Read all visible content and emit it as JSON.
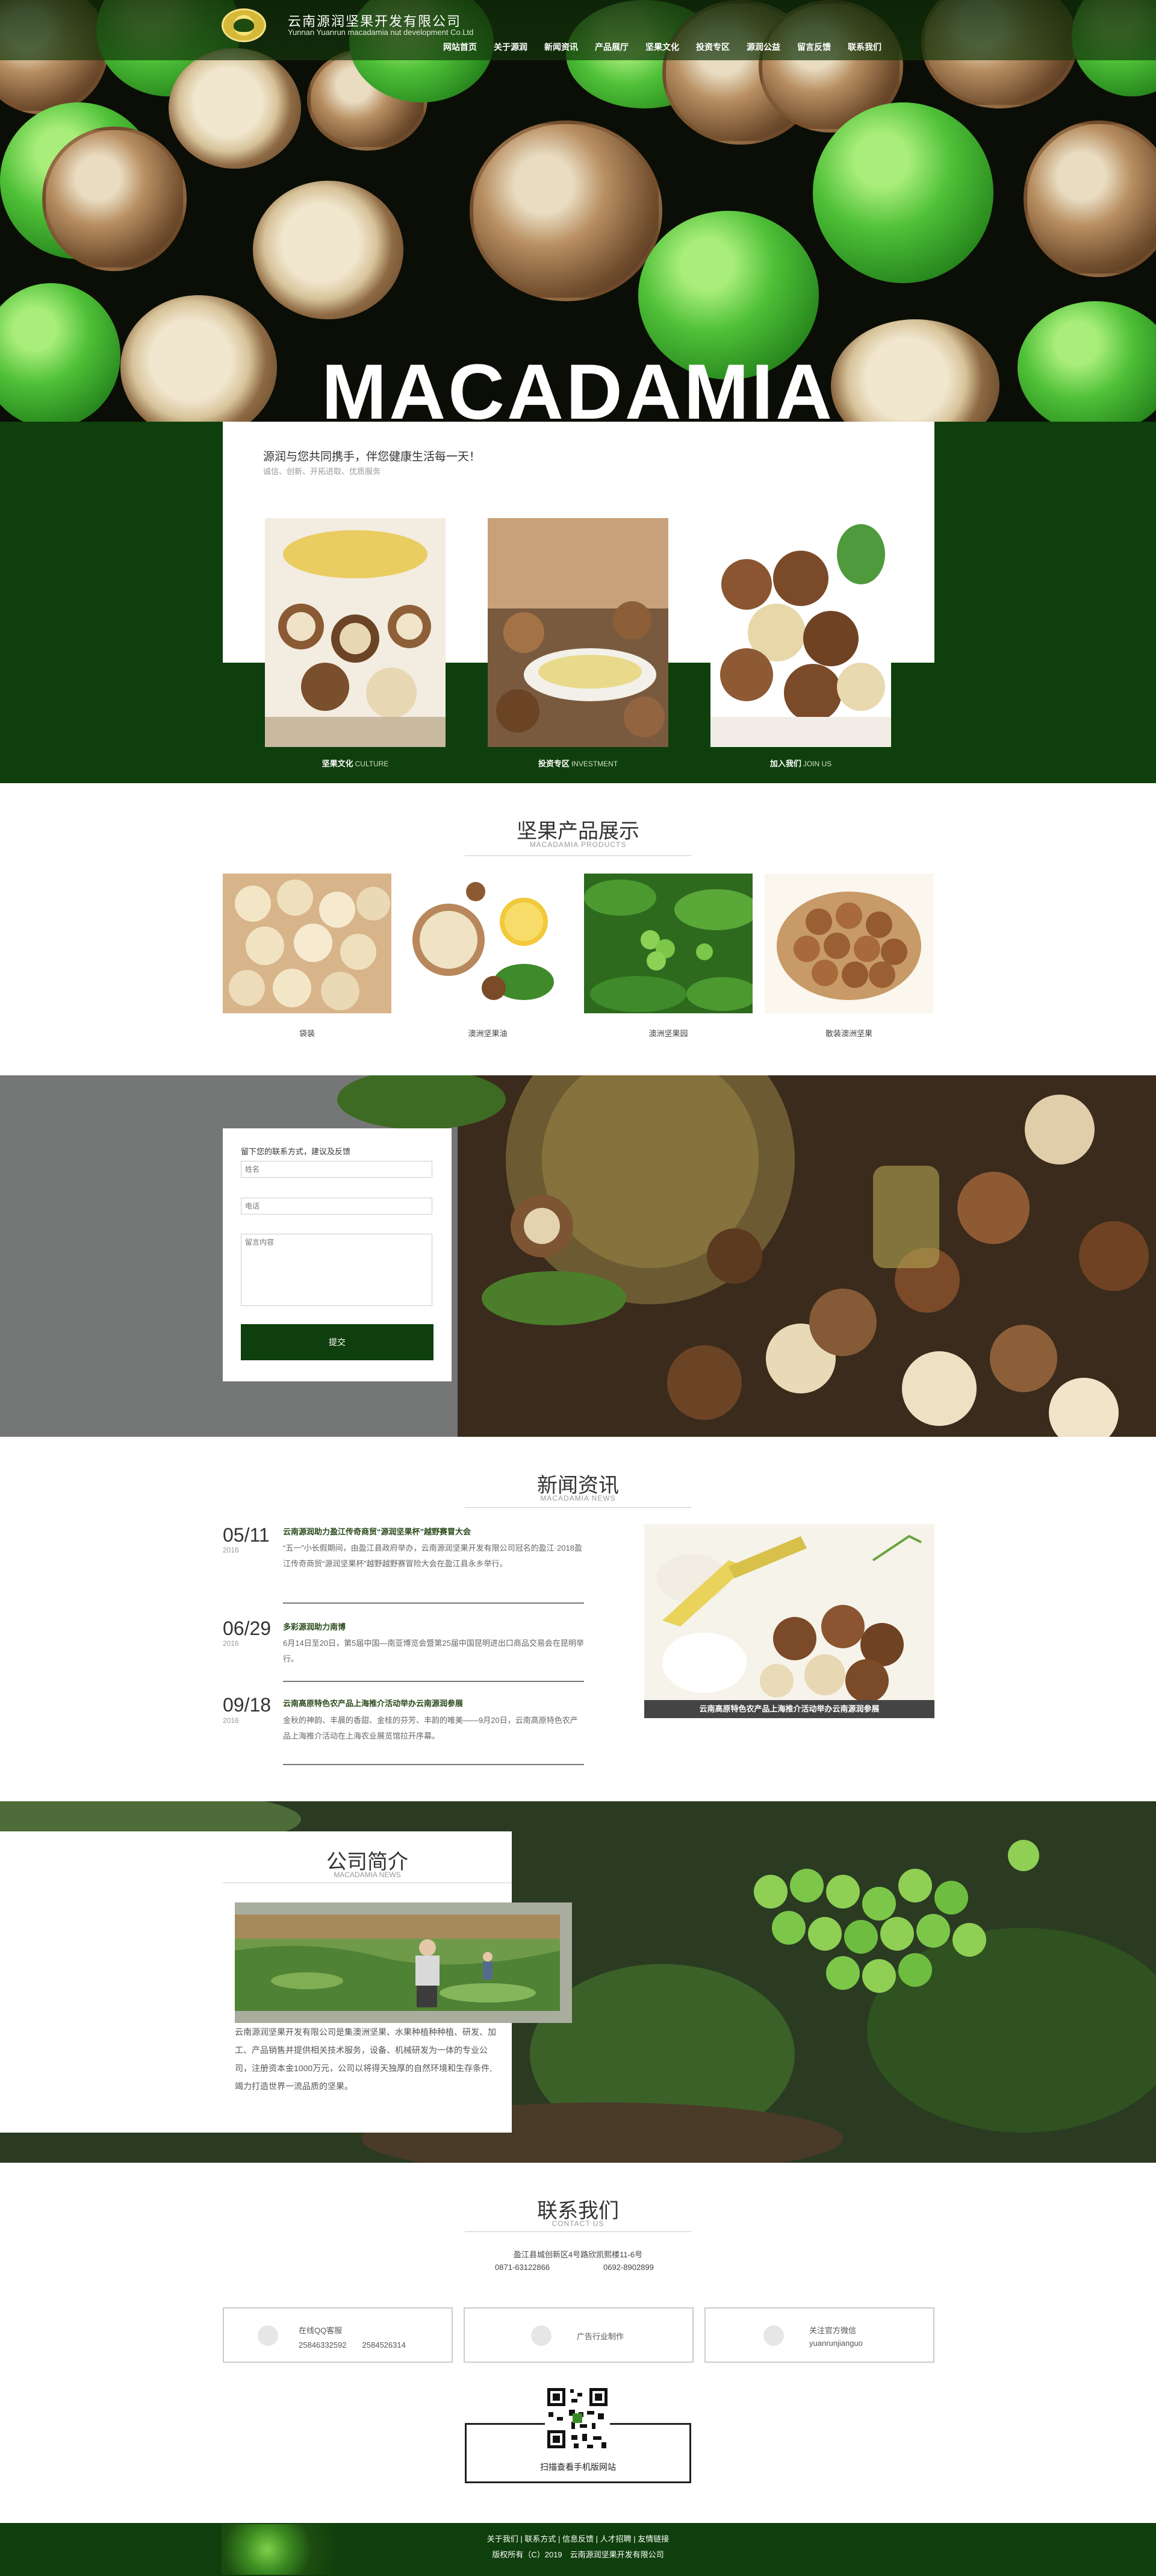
{
  "header": {
    "company_cn": "云南源润坚果开发有限公司",
    "company_en": "Yunnan Yuanrun macadamia nut development Co.Ltd",
    "nav": [
      "网站首页",
      "关于源润",
      "新闻资讯",
      "产品展厅",
      "坚果文化",
      "投资专区",
      "源润公益",
      "留言反馈",
      "联系我们"
    ]
  },
  "hero": {
    "title": "MACADAMIA"
  },
  "intro": {
    "slogan": "源润与您共同携手，伴您健康生活每一天！",
    "sub": "诚信、创新、开拓进取、优质服务",
    "cards": [
      {
        "label": "坚果文化",
        "en": "CULTURE"
      },
      {
        "label": "投资专区",
        "en": "INVESTMENT"
      },
      {
        "label": "加入我们",
        "en": "JOIN US"
      }
    ]
  },
  "products": {
    "title": "坚果产品展示",
    "subtitle": "MACADAMIA PRODUCTS",
    "items": [
      "袋装",
      "澳洲坚果油",
      "澳洲坚果园",
      "散装澳洲坚果"
    ]
  },
  "form": {
    "title": "留下您的联系方式，建议及反馈",
    "name_placeholder": "姓名",
    "phone_placeholder": "电话",
    "message_placeholder": "留言内容",
    "submit": "提交"
  },
  "news": {
    "title": "新闻资讯",
    "subtitle": "MACADAMIA NEWS",
    "items": [
      {
        "date": "05/11",
        "year": "2016",
        "headline": "云南源润助力盈江传奇商贸“源润坚果杯”越野赛冒大会",
        "text": "“五一”小长假期间，由盈江县政府举办，云南源润坚果开发有限公司冠名的盈江·2018盈江传奇商贸“源润坚果杯”越野越野赛冒险大会在盈江县永乡举行。"
      },
      {
        "date": "06/29",
        "year": "2016",
        "headline": "多彩源润助力南博",
        "text": "6月14日至20日，第5届中国—南亚博览会暨第25届中国昆明进出口商品交易会在昆明举行。"
      },
      {
        "date": "09/18",
        "year": "2016",
        "headline": "云南高原特色农产品上海推介活动举办云南源润参展",
        "text": "金秋的神韵、丰晨的香甜、金桂的芬芳、丰韵的唯美——9月20日，云南高原特色农产品上海推介活动在上海农业展览馆拉开序幕。"
      }
    ],
    "image_caption": "云南高原特色农产品上海推介活动举办云南源润参展"
  },
  "about": {
    "title": "公司简介",
    "subtitle": "MACADAMIA NEWS",
    "text": "云南源润坚果开发有限公司是集澳洲坚果、水果种植种种植、研发、加工、产品销售并提供相关技术服务，设备、机械研发为一体的专业公司，注册资本金1000万元，公司以将得天独厚的自然环境和生存条件,竭力打造世界一流品质的坚果。"
  },
  "contact": {
    "title": "联系我们",
    "subtitle": "CONTACT US",
    "address": "盈江县城创新区4号路欣凯熙楼11-6号",
    "phone1": "0871-63122866",
    "phone2": "0692-8902899",
    "boxes": [
      {
        "line1": "在线QQ客服",
        "line2": "25846332592　　2584526314"
      },
      {
        "line1": "广告行业制作",
        "line2": ""
      },
      {
        "line1": "关注官方微信",
        "line2": "yuanrunjianguo"
      }
    ],
    "qr_caption": "扫描查看手机版网站"
  },
  "footer": {
    "links": "关于我们 | 联系方式 | 信息反馈 | 人才招聘 | 友情链接",
    "copyright": "版权所有（C）2019　云南源润坚果开发有限公司"
  },
  "colors": {
    "brand_green": "#0f3f0c",
    "accent": "#2a4a1b"
  }
}
